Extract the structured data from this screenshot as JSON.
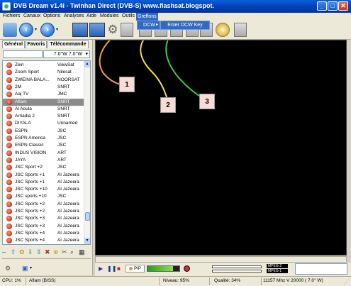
{
  "window": {
    "title": "DVB Dream v1.4i  -  Twinhan Direct (DVB-S)  www.flashsat.blogspot.",
    "minimize_label": "_",
    "maximize_label": "□",
    "close_label": "✕"
  },
  "menu": [
    {
      "label": "Fichiers"
    },
    {
      "label": "Canaux"
    },
    {
      "label": "Options"
    },
    {
      "label": "Analyses"
    },
    {
      "label": "Aide"
    },
    {
      "label": "Modules"
    },
    {
      "label": "Outils"
    },
    {
      "label": "Greffons"
    }
  ],
  "greffons_menu": {
    "item": "DCW",
    "submenu_item": "Enter DCW Key"
  },
  "left_panel": {
    "tabs": [
      "Général",
      "Favoris",
      "Télécommande"
    ],
    "filter_value": "",
    "position_value": "7.0°W  7.0°W",
    "channels": [
      {
        "name": "Zein",
        "provider": "ViewSat"
      },
      {
        "name": "Zoom Sport",
        "provider": "Nilesat"
      },
      {
        "name": "ZWEINA BALA...",
        "provider": "NOORSAT"
      },
      {
        "name": "2M",
        "provider": "SNRT"
      },
      {
        "name": "Aaj TV",
        "provider": "JMC"
      },
      {
        "name": "Aflam",
        "provider": "SNRT",
        "selected": true
      },
      {
        "name": "Al Aoula",
        "provider": "SNRT"
      },
      {
        "name": "Arriadia 2",
        "provider": "SNRT"
      },
      {
        "name": "DIYALA",
        "provider": "Unnamed"
      },
      {
        "name": "ESPN",
        "provider": "JSC"
      },
      {
        "name": "ESPN America",
        "provider": "JSC"
      },
      {
        "name": "ESPN Classic",
        "provider": "JSC"
      },
      {
        "name": "INDUS VISION",
        "provider": "ART"
      },
      {
        "name": "JAYA",
        "provider": "ART"
      },
      {
        "name": "JSC Sport +2",
        "provider": "JSC"
      },
      {
        "name": "JSC Sports +1",
        "provider": "Al Jazeera"
      },
      {
        "name": "JSC Sports +1",
        "provider": "Al Jazeera"
      },
      {
        "name": "JSC Sports +10",
        "provider": "Al Jazeera"
      },
      {
        "name": "JSC sports +10",
        "provider": "JSC"
      },
      {
        "name": "JSC Sports +2",
        "provider": "Al Jazeera"
      },
      {
        "name": "JSC Sports +2",
        "provider": "Al Jazeera"
      },
      {
        "name": "JSC Sports +3",
        "provider": "Al Jazeera"
      },
      {
        "name": "JSC Sports +3",
        "provider": "Al Jazeera"
      },
      {
        "name": "JSC Sports +4",
        "provider": "Al Jazeera"
      },
      {
        "name": "JSC Sports +4",
        "provider": "Al Jazeera"
      }
    ]
  },
  "callouts": [
    "1",
    "2",
    "3"
  ],
  "controls": {
    "pip_label": "PIP",
    "signal_level_fraction": 0.8,
    "mpeg_top": "MPEG-2",
    "mpeg_bottom": "MPEG-1"
  },
  "status": {
    "cpu": "CPU: 1%",
    "channel": "Aflam (BISS)",
    "level": "Niveau: 95%",
    "quality": "Qualité: 34%",
    "frequency": "11157 Mhz  V  20000  ( 7.0° W)"
  },
  "colors": {
    "callout_line_1": "#f0a040",
    "callout_line_2": "#f3e24a",
    "callout_line_3": "#3ad33a",
    "selection": "#316ac5"
  }
}
